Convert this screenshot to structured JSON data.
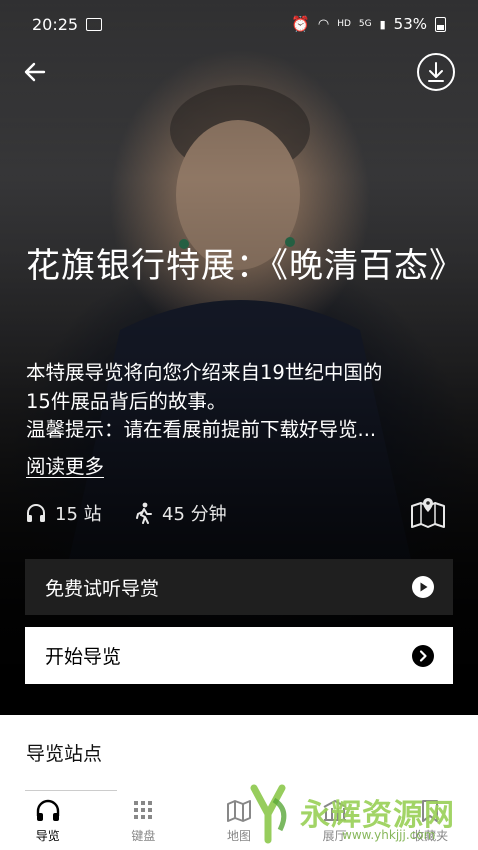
{
  "status": {
    "time": "20:25",
    "network": "HD",
    "signal": "5G",
    "battery": "53%"
  },
  "header": {
    "back_icon": "arrow-left-icon",
    "download_icon": "download-icon"
  },
  "exhibit": {
    "title": "花旗银行特展：《晚清百态》",
    "description_line1": "本特展导览将向您介绍来自19世纪中国的",
    "description_line2": "15件展品背后的故事。",
    "description_line3": "温馨提示：请在看展前提前下载好导览...",
    "read_more": "阅读更多",
    "stops": "15 站",
    "duration": "45 分钟"
  },
  "buttons": {
    "trial": "免费试听导赏",
    "start": "开始导览"
  },
  "section": {
    "title": "导览站点"
  },
  "tabs": [
    {
      "label": "导览",
      "icon": "headphones-icon"
    },
    {
      "label": "键盘",
      "icon": "keypad-icon"
    },
    {
      "label": "地图",
      "icon": "map-icon"
    },
    {
      "label": "展厅",
      "icon": "gallery-icon"
    },
    {
      "label": "收藏夹",
      "icon": "bookmark-icon"
    }
  ],
  "watermark": {
    "text": "永辉资源网",
    "url": "www.yhkjjj.com"
  },
  "colors": {
    "dark_button": "#1f1f1f",
    "watermark": "#9bd15a"
  }
}
